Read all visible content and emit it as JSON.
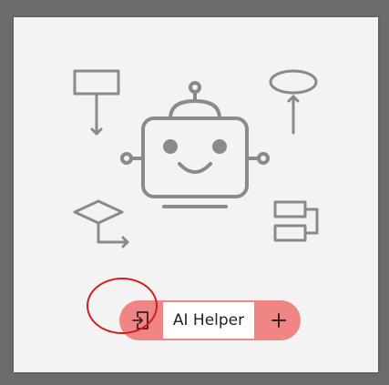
{
  "plugin": {
    "name_label": "AI Helper",
    "import_icon": "file-import-icon",
    "add_icon": "plus-icon",
    "illustration_icon": "robot-flowchart-illustration"
  },
  "colors": {
    "pill": "#f08585",
    "icon_stroke": "#8a8a8a",
    "highlight": "#d21d1d",
    "card": "#f3f3f3",
    "backdrop": "#6b6b6b"
  }
}
